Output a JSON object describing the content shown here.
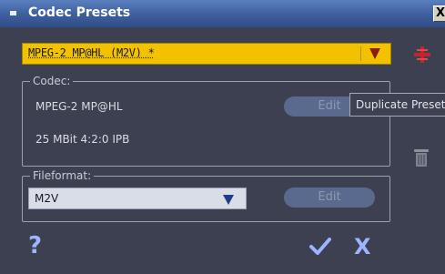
{
  "window": {
    "title": "Codec Presets",
    "close_label": "X"
  },
  "preset": {
    "selected": "MPEG-2 MP@HL (M2V) *"
  },
  "codec_group": {
    "legend": "Codec:",
    "codec_name": "MPEG-2 MP@HL",
    "codec_details": "25 MBit 4:2:0 IPB",
    "edit_label": "Edit"
  },
  "tooltip": {
    "text": "Duplicate Preset"
  },
  "format_group": {
    "legend": "Fileformat:",
    "selected": "M2V",
    "edit_label": "Edit"
  },
  "footer": {
    "help_label": "?",
    "cancel_label": "X"
  },
  "icons": {
    "duplicate": "duplicate-preset-icon",
    "delete": "trash-icon",
    "ok": "checkmark-icon"
  },
  "colors": {
    "titlebar": "#40619f",
    "background": "#3d4050",
    "preset_select": "#f2c200",
    "accent_red": "#c0262a",
    "accent_blue": "#9fb4ff"
  }
}
